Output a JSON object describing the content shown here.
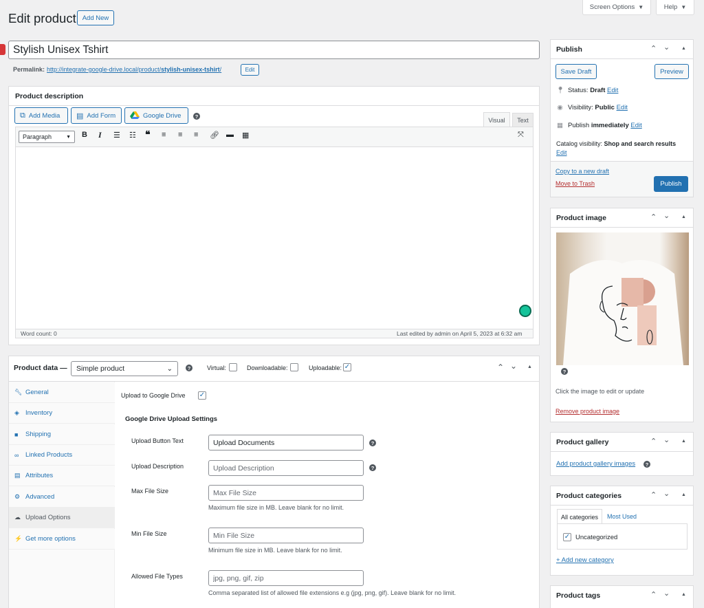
{
  "header": {
    "title": "Edit product",
    "add_new": "Add New",
    "screen_options": "Screen Options",
    "help": "Help"
  },
  "title_field": {
    "value": "Stylish Unisex Tshirt"
  },
  "permalink": {
    "label": "Permalink:",
    "url_base": "http://integrate-google-drive.local/product/",
    "slug": "stylish-unisex-tshirt",
    "url_end": "/",
    "edit": "Edit"
  },
  "description": {
    "title": "Product description",
    "add_media": "Add Media",
    "add_form": "Add Form",
    "google_drive": "Google Drive",
    "tab_visual": "Visual",
    "tab_text": "Text",
    "format_select": "Paragraph",
    "word_count": "Word count: 0",
    "last_edited": "Last edited by admin on April 5, 2023 at 6:32 am"
  },
  "product_data": {
    "title": "Product data —",
    "type_select": "Simple product",
    "virtual_label": "Virtual:",
    "virtual_checked": false,
    "downloadable_label": "Downloadable:",
    "downloadable_checked": false,
    "uploadable_label": "Uploadable:",
    "uploadable_checked": true,
    "tabs": [
      {
        "label": "General",
        "icon": "wrench-icon"
      },
      {
        "label": "Inventory",
        "icon": "tag-icon"
      },
      {
        "label": "Shipping",
        "icon": "truck-icon"
      },
      {
        "label": "Linked Products",
        "icon": "link-icon"
      },
      {
        "label": "Attributes",
        "icon": "list-icon"
      },
      {
        "label": "Advanced",
        "icon": "gear-icon"
      },
      {
        "label": "Upload Options",
        "icon": "cloud-icon"
      },
      {
        "label": "Get more options",
        "icon": "plugin-icon"
      }
    ],
    "active_tab": "Upload Options",
    "upload_to_drive_label": "Upload to Google Drive",
    "upload_to_drive_checked": true,
    "settings_heading": "Google Drive Upload Settings",
    "fields": {
      "button_text": {
        "label": "Upload Button Text",
        "value": "Upload Documents"
      },
      "description": {
        "label": "Upload Description",
        "placeholder": "Upload Description"
      },
      "max_size": {
        "label": "Max File Size",
        "placeholder": "Max File Size",
        "help": "Maximum file size in MB. Leave blank for no limit."
      },
      "min_size": {
        "label": "Min File Size",
        "placeholder": "Min File Size",
        "help": "Minimum file size in MB. Leave blank for no limit."
      },
      "allowed_types": {
        "label": "Allowed File Types",
        "placeholder": "jpg, png, gif, zip",
        "help": "Comma separated list of allowed file extensions e.g (jpg, png, gif). Leave blank for no limit."
      }
    }
  },
  "publish": {
    "title": "Publish",
    "save_draft": "Save Draft",
    "preview": "Preview",
    "status_label": "Status:",
    "status_value": "Draft",
    "visibility_label": "Visibility:",
    "visibility_value": "Public",
    "publish_label": "Publish",
    "publish_value": "immediately",
    "edit": "Edit",
    "catalog_label": "Catalog visibility:",
    "catalog_value": "Shop and search results",
    "copy_draft": "Copy to a new draft",
    "trash": "Move to Trash",
    "publish_button": "Publish"
  },
  "product_image": {
    "title": "Product image",
    "hint": "Click the image to edit or update",
    "remove": "Remove product image"
  },
  "gallery": {
    "title": "Product gallery",
    "add": "Add product gallery images"
  },
  "categories": {
    "title": "Product categories",
    "tab_all": "All categories",
    "tab_used": "Most Used",
    "items": [
      {
        "label": "Uncategorized",
        "checked": true
      }
    ],
    "add_new": "+ Add new category"
  },
  "tags": {
    "title": "Product tags"
  },
  "colors": {
    "accent": "#2271b1",
    "danger": "#b32d2e",
    "primary_button": "#2271b1"
  }
}
